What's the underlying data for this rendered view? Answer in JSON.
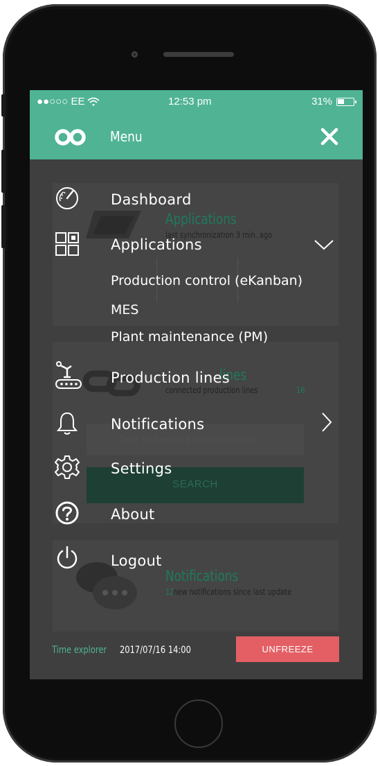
{
  "status_bar": {
    "carrier": "●●○○○ EE",
    "time": "12:53 pm",
    "battery": "31%"
  },
  "header": {
    "title": "Menu",
    "logo_icon": "infinity-loop-icon",
    "close_icon": "close-icon"
  },
  "menu": {
    "items": [
      {
        "label": "Dashboard",
        "icon": "speedometer-icon"
      },
      {
        "label": "Applications",
        "icon": "grid-apps-icon"
      },
      {
        "label": "Production lines",
        "icon": "conveyor-robot-icon"
      },
      {
        "label": "Notifications",
        "icon": "bell-icon"
      },
      {
        "label": "Settings",
        "icon": "gear-icon"
      },
      {
        "label": "About",
        "icon": "help-circle-icon"
      },
      {
        "label": "Logout",
        "icon": "power-icon"
      }
    ],
    "applications_sub": [
      "Production control (eKanban)",
      "MES",
      "Plant maintenance (PM)"
    ]
  },
  "background": {
    "applications_title": "Applications",
    "applications_sync": "last synchronization 3 min. ago",
    "production_lines_title": "lines",
    "production_lines_sub": "connected production lines",
    "production_lines_count": "16",
    "search_placeholder": "Type to Search a production line",
    "search_button": "SEARCH",
    "notifications_title": "Notifications",
    "notifications_sub": "new notifications since last update",
    "notifications_count": "12"
  },
  "footer": {
    "time_explorer_label": "Time explorer",
    "time_explorer_value": "2017/07/16 14:00",
    "unfreeze_label": "UNFREEZE"
  },
  "colors": {
    "accent": "#4fb394",
    "overlay": "#3f3f3f",
    "unfreeze": "#e35f64"
  }
}
